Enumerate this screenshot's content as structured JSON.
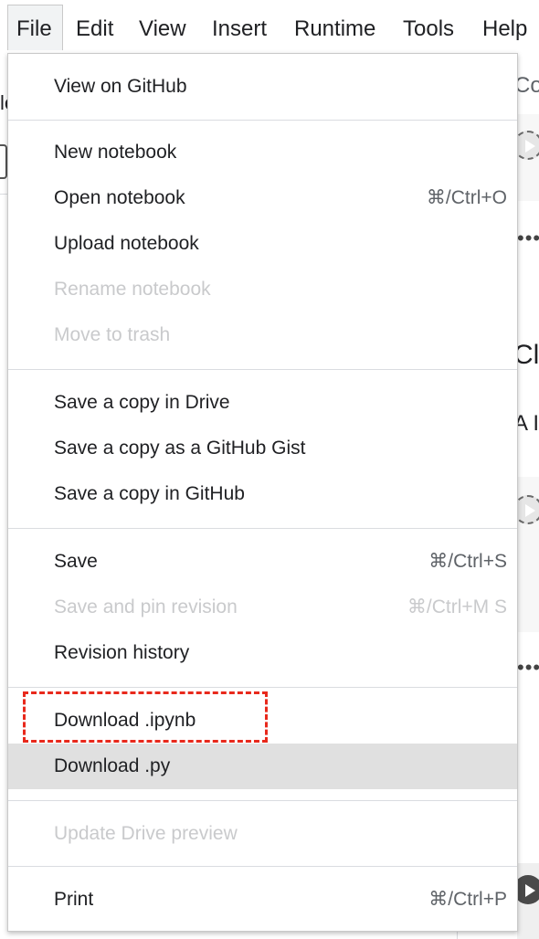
{
  "menubar": {
    "items": [
      "File",
      "Edit",
      "View",
      "Insert",
      "Runtime",
      "Tools",
      "Help"
    ],
    "active": "File"
  },
  "background": {
    "fragments": {
      "right_top": "Co",
      "right_heading": "Cla",
      "right_text": "A I'",
      "left_top": "le",
      "ellipsis": "•••"
    }
  },
  "file_menu": {
    "items": [
      {
        "label": "View on GitHub",
        "shortcut": "",
        "disabled": false
      },
      {
        "label": "New notebook",
        "shortcut": "",
        "disabled": false
      },
      {
        "label": "Open notebook",
        "shortcut": "⌘/Ctrl+O",
        "disabled": false
      },
      {
        "label": "Upload notebook",
        "shortcut": "",
        "disabled": false
      },
      {
        "label": "Rename notebook",
        "shortcut": "",
        "disabled": true
      },
      {
        "label": "Move to trash",
        "shortcut": "",
        "disabled": true
      },
      {
        "label": "Save a copy in Drive",
        "shortcut": "",
        "disabled": false
      },
      {
        "label": "Save a copy as a GitHub Gist",
        "shortcut": "",
        "disabled": false
      },
      {
        "label": "Save a copy in GitHub",
        "shortcut": "",
        "disabled": false
      },
      {
        "label": "Save",
        "shortcut": "⌘/Ctrl+S",
        "disabled": false
      },
      {
        "label": "Save and pin revision",
        "shortcut": "⌘/Ctrl+M S",
        "disabled": true
      },
      {
        "label": "Revision history",
        "shortcut": "",
        "disabled": false
      },
      {
        "label": "Download .ipynb",
        "shortcut": "",
        "disabled": false,
        "annotated": true
      },
      {
        "label": "Download .py",
        "shortcut": "",
        "disabled": false,
        "hovered": true
      },
      {
        "label": "Update Drive preview",
        "shortcut": "",
        "disabled": true
      },
      {
        "label": "Print",
        "shortcut": "⌘/Ctrl+P",
        "disabled": false
      }
    ]
  },
  "colors": {
    "annotation_border": "#e8291c",
    "hover_background": "#e0e0e0",
    "disabled_text": "#c9cacc"
  }
}
